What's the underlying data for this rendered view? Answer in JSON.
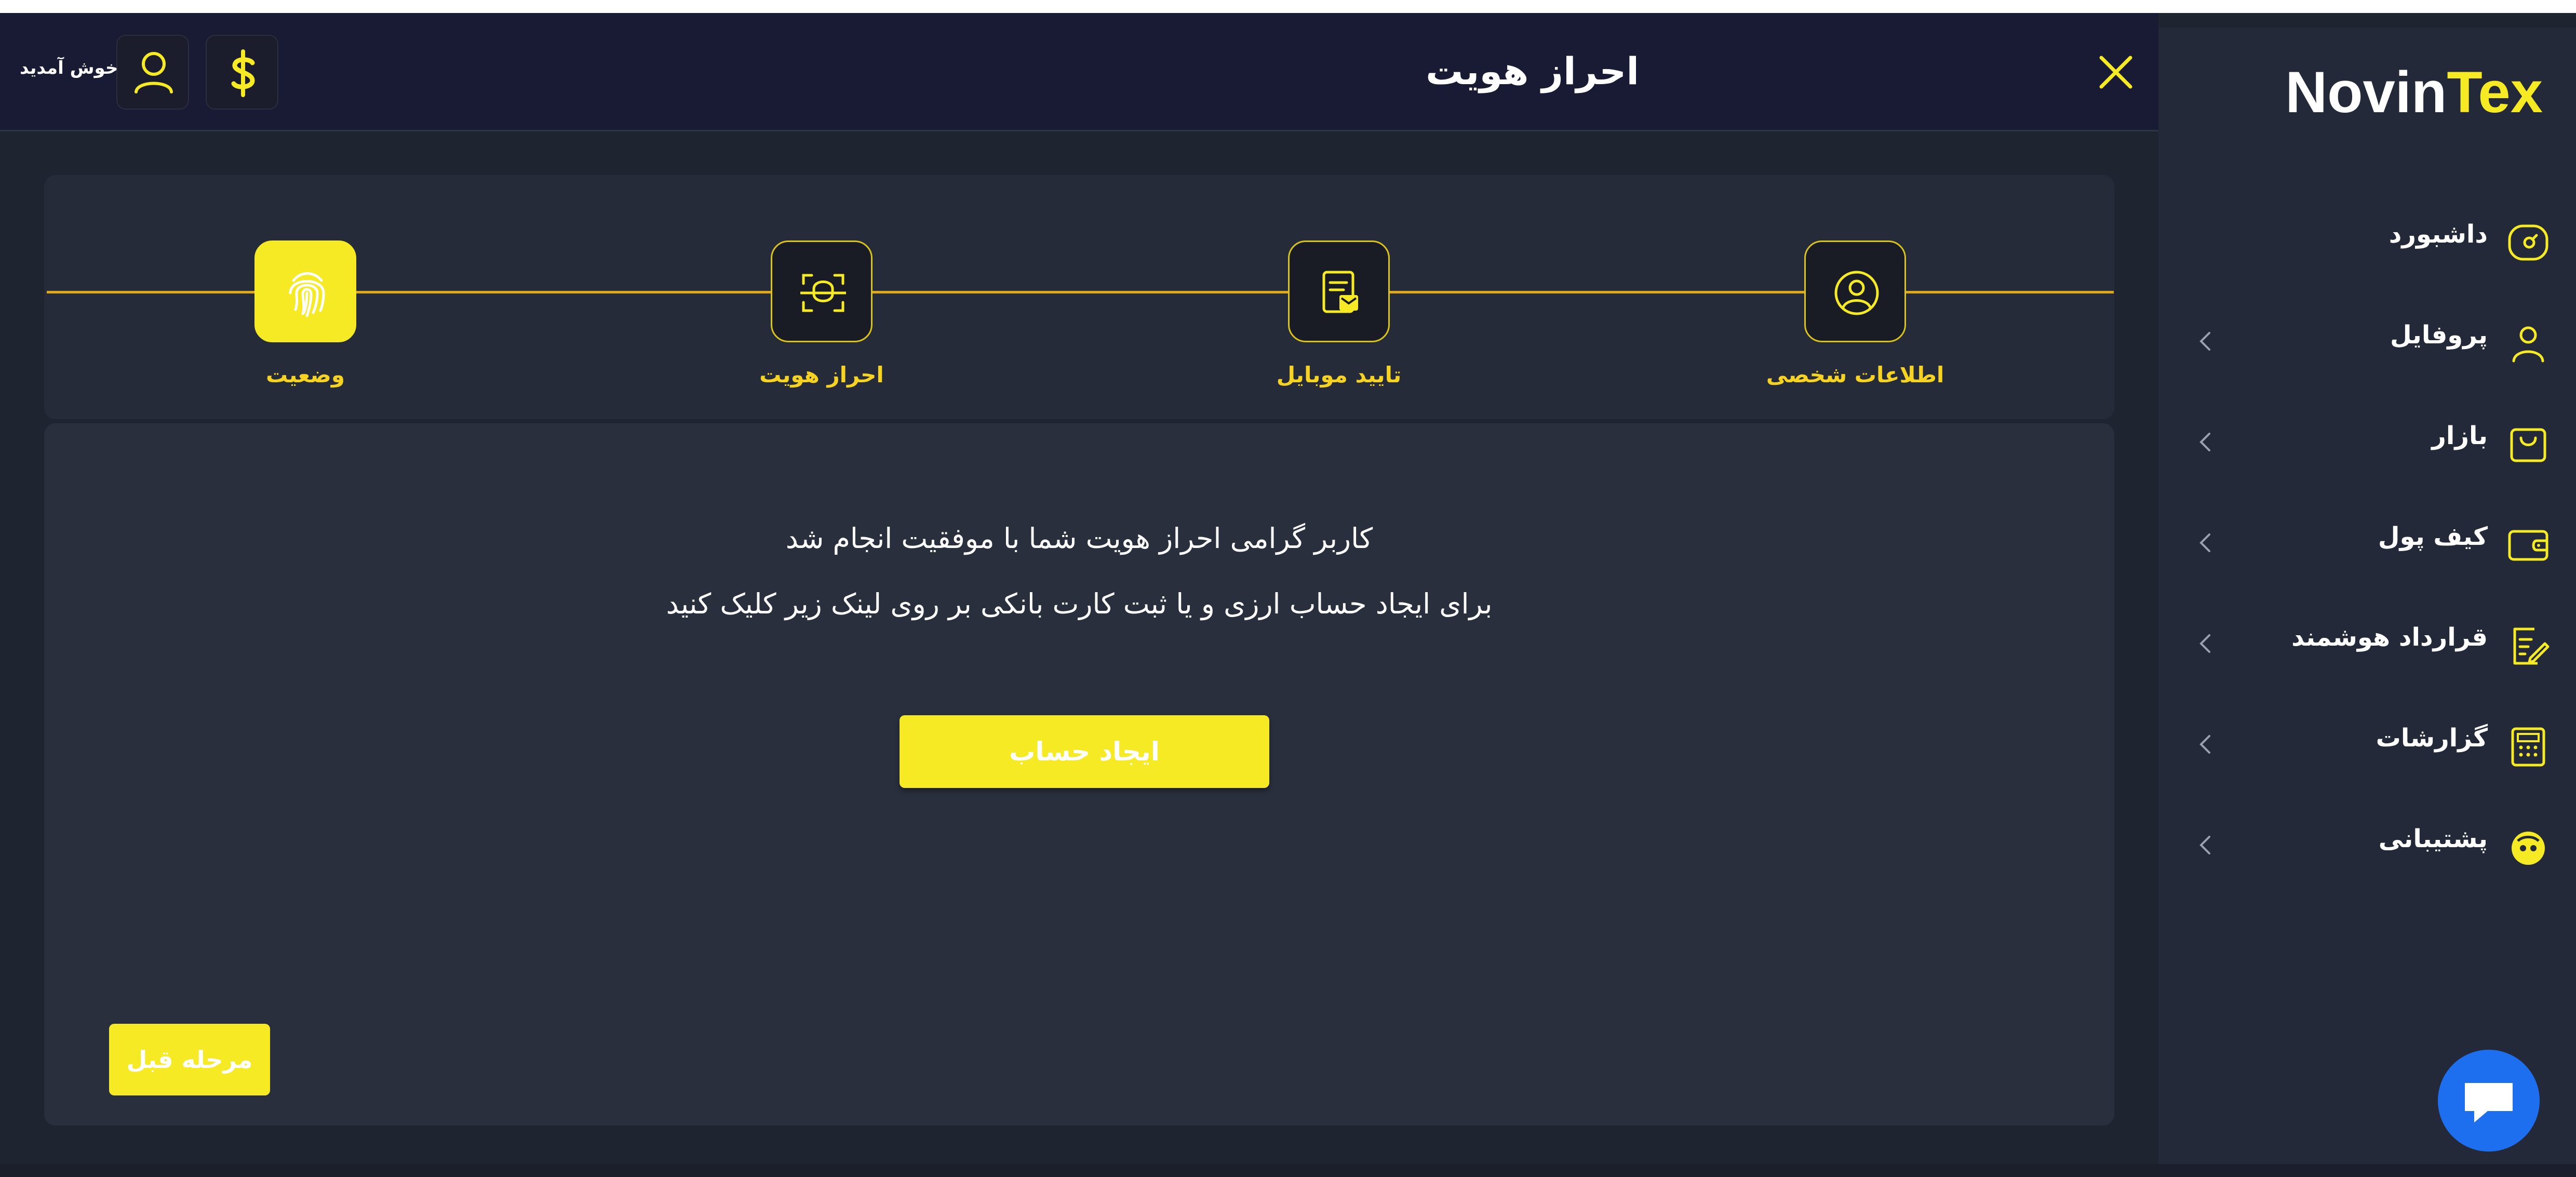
{
  "brand": {
    "part1": "Novin",
    "part2": "Tex",
    "accent": "#f6ea24"
  },
  "header": {
    "title": "احراز هویت",
    "welcome": "خوش آمدید"
  },
  "sidebar": {
    "items": [
      {
        "label": "داشبورد",
        "icon": "dashboard-icon",
        "has_chevron": false
      },
      {
        "label": "پروفایل",
        "icon": "user-icon",
        "has_chevron": true
      },
      {
        "label": "بازار",
        "icon": "shopping-bag-icon",
        "has_chevron": true
      },
      {
        "label": "کیف پول",
        "icon": "wallet-icon",
        "has_chevron": true
      },
      {
        "label": "قرارداد هوشمند",
        "icon": "contract-edit-icon",
        "has_chevron": true
      },
      {
        "label": "گزارشات",
        "icon": "calculator-icon",
        "has_chevron": true
      },
      {
        "label": "پشتیبانی",
        "icon": "support-icon",
        "has_chevron": true
      }
    ]
  },
  "steps": [
    {
      "label": "اطلاعات شخصی",
      "icon": "user-circle-icon",
      "active": false
    },
    {
      "label": "تایید موبایل",
      "icon": "document-check-icon",
      "active": false
    },
    {
      "label": "احراز هویت",
      "icon": "face-scan-icon",
      "active": false
    },
    {
      "label": "وضعیت",
      "icon": "fingerprint-icon",
      "active": true
    }
  ],
  "content": {
    "message_line1": "کاربر گرامی احراز هویت شما با موفقیت انجام شد",
    "message_line2": "برای ایجاد حساب ارزی و یا ثبت کارت بانکی بر روی لینک زیر کلیک کنید",
    "create_button": "ایجاد حساب",
    "prev_button": "مرحله قبل"
  },
  "colors": {
    "background": "#1f2431",
    "header": "#191a33",
    "sidebar": "#232938",
    "accent": "#f6ea24",
    "chat": "#1e6ff0"
  }
}
